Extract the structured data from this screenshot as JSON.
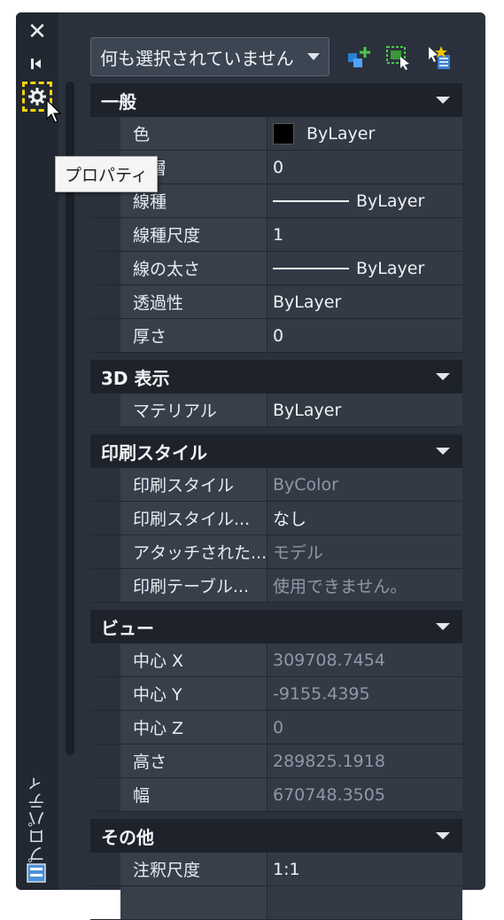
{
  "sidebar": {
    "title": "プロパティ"
  },
  "toolbar": {
    "selection": "何も選択されていません"
  },
  "tooltip": "プロパティ",
  "sections": [
    {
      "title": "一般",
      "rows": [
        {
          "name": "色",
          "value": "ByLayer",
          "swatch": true
        },
        {
          "name": "画層",
          "value": "0"
        },
        {
          "name": "線種",
          "value": "ByLayer",
          "line": true
        },
        {
          "name": "線種尺度",
          "value": "1"
        },
        {
          "name": "線の太さ",
          "value": "ByLayer",
          "line": true
        },
        {
          "name": "透過性",
          "value": "ByLayer"
        },
        {
          "name": "厚さ",
          "value": "0"
        }
      ]
    },
    {
      "title": "3D 表示",
      "rows": [
        {
          "name": "マテリアル",
          "value": "ByLayer"
        }
      ]
    },
    {
      "title": "印刷スタイル",
      "rows": [
        {
          "name": "印刷スタイル",
          "value": "ByColor",
          "readonly": true
        },
        {
          "name": "印刷スタイル...",
          "value": "なし"
        },
        {
          "name": "アタッチされた...",
          "value": "モデル",
          "readonly": true
        },
        {
          "name": "印刷テーブル...",
          "value": "使用できません。",
          "readonly": true
        }
      ]
    },
    {
      "title": "ビュー",
      "rows": [
        {
          "name": "中心 X",
          "value": "309708.7454",
          "readonly": true
        },
        {
          "name": "中心 Y",
          "value": "-9155.4395",
          "readonly": true
        },
        {
          "name": "中心 Z",
          "value": "0",
          "readonly": true
        },
        {
          "name": "高さ",
          "value": "289825.1918",
          "readonly": true
        },
        {
          "name": "幅",
          "value": "670748.3505",
          "readonly": true
        }
      ]
    },
    {
      "title": "その他",
      "rows": [
        {
          "name": "注釈尺度",
          "value": "1:1"
        },
        {
          "name": "",
          "value": ""
        }
      ]
    }
  ]
}
